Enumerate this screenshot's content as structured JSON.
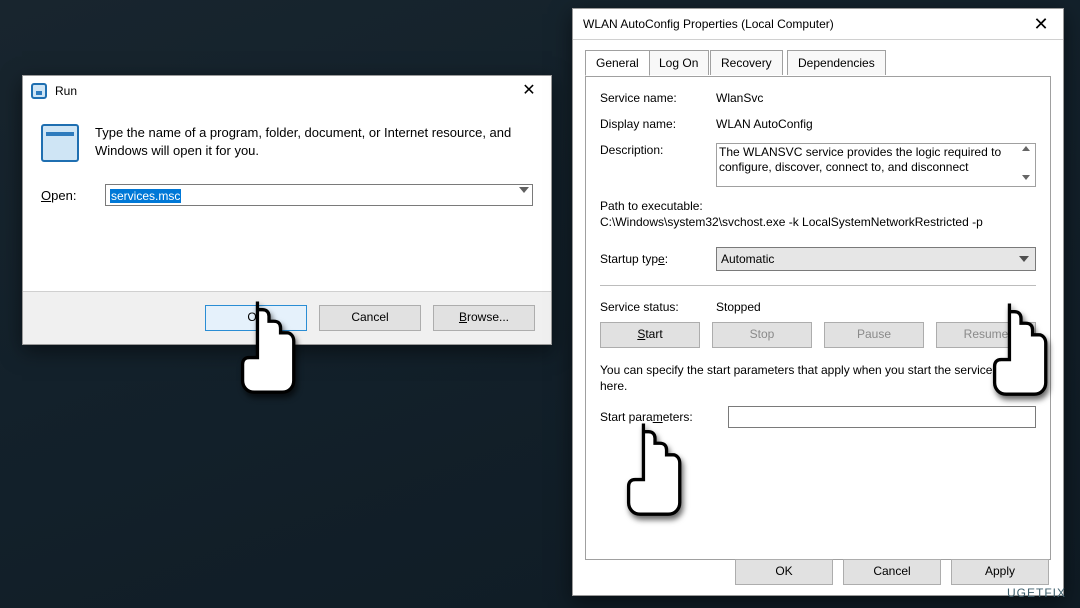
{
  "run": {
    "title": "Run",
    "message": "Type the name of a program, folder, document, or Internet resource, and Windows will open it for you.",
    "open_label": "Open:",
    "open_value": "services.msc",
    "ok_label": "OK",
    "cancel_label": "Cancel",
    "browse_label": "Browse..."
  },
  "props": {
    "title": "WLAN AutoConfig Properties (Local Computer)",
    "tabs": [
      "General",
      "Log On",
      "Recovery",
      "Dependencies"
    ],
    "service_name_label": "Service name:",
    "service_name": "WlanSvc",
    "display_name_label": "Display name:",
    "display_name": "WLAN AutoConfig",
    "description_label": "Description:",
    "description": "The WLANSVC service provides the logic required to configure, discover, connect to, and disconnect",
    "path_label": "Path to executable:",
    "path_value": "C:\\Windows\\system32\\svchost.exe -k LocalSystemNetworkRestricted -p",
    "startup_label": "Startup type:",
    "startup_value": "Automatic",
    "status_label": "Service status:",
    "status_value": "Stopped",
    "start_label": "Start",
    "stop_label": "Stop",
    "pause_label": "Pause",
    "resume_label": "Resume",
    "hint": "You can specify the start parameters that apply when you start the service from here.",
    "start_params_label": "Start parameters:",
    "start_params_value": "",
    "ok_label": "OK",
    "cancel_label": "Cancel",
    "apply_label": "Apply"
  },
  "watermark": "UGETFIX"
}
